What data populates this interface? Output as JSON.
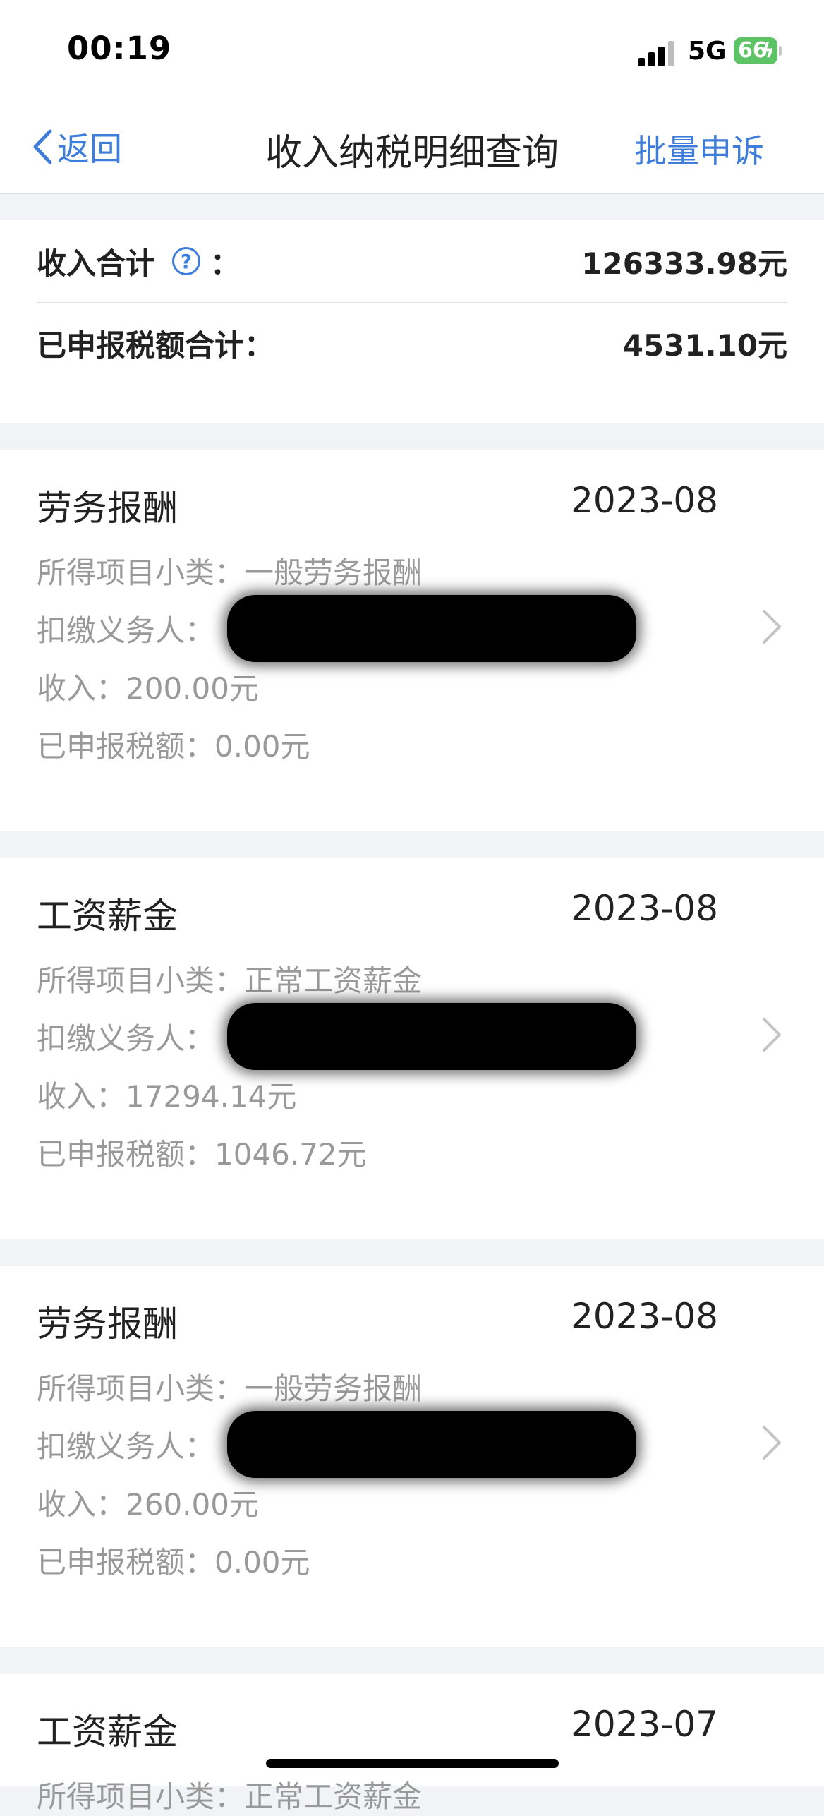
{
  "status": {
    "time": "00:19",
    "network": "5G",
    "battery": "66"
  },
  "nav": {
    "back_label": "返回",
    "title": "收入纳税明细查询",
    "action_label": "批量申诉"
  },
  "summary": {
    "income_label": "收入合计",
    "income_colon": "：",
    "income_value": "126333.98元",
    "tax_label": "已申报税额合计：",
    "tax_value": "4531.10元"
  },
  "records": [
    {
      "title": "劳务报酬",
      "date": "2023-08",
      "subcategory": "所得项目小类：一般劳务报酬",
      "withholder": "扣缴义务人：",
      "income": "收入：200.00元",
      "tax": "已申报税额：0.00元"
    },
    {
      "title": "工资薪金",
      "date": "2023-08",
      "subcategory": "所得项目小类：正常工资薪金",
      "withholder": "扣缴义务人：",
      "income": "收入：17294.14元",
      "tax": "已申报税额：1046.72元"
    },
    {
      "title": "劳务报酬",
      "date": "2023-08",
      "subcategory": "所得项目小类：一般劳务报酬",
      "withholder": "扣缴义务人：",
      "income": "收入：260.00元",
      "tax": "已申报税额：0.00元"
    },
    {
      "title": "工资薪金",
      "date": "2023-07",
      "subcategory": "所得项目小类：正常工资薪金"
    }
  ],
  "colors": {
    "accent": "#3f7ddb",
    "background": "#f2f3f7",
    "muted_text": "#999999"
  },
  "icons": {
    "back": "chevron-left-icon",
    "help": "question-circle-icon",
    "row": "chevron-right-icon"
  }
}
